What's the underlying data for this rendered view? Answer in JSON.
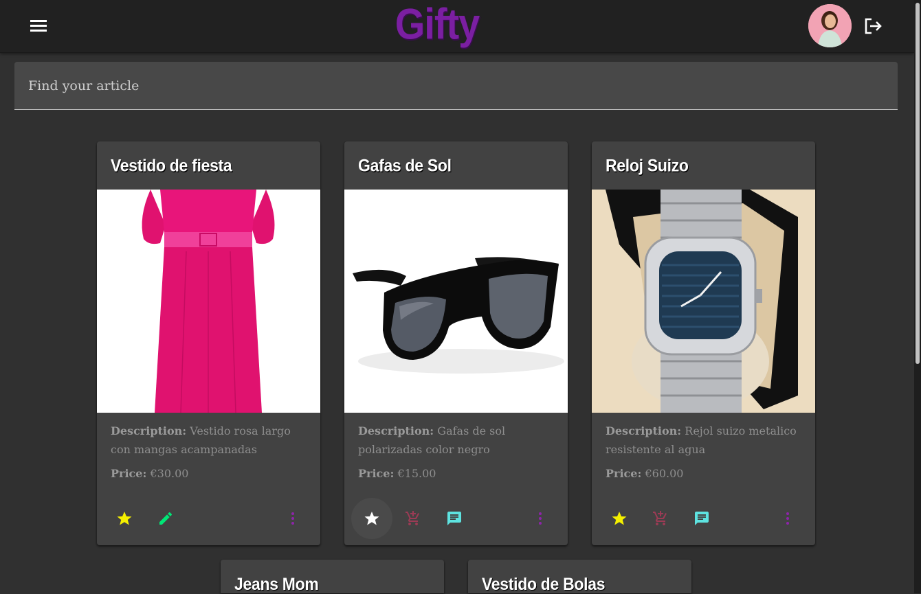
{
  "app": {
    "title": "Gifty"
  },
  "search": {
    "placeholder": "Find your article"
  },
  "labels": {
    "description": "Description:",
    "price": "Price:"
  },
  "colors": {
    "brand": "#7b1fa2",
    "star": "#f5f000",
    "edit": "#00e676",
    "cart": "#9c3b55",
    "comment": "#5ee3e0",
    "more": "#8e24aa"
  },
  "products": [
    {
      "title": "Vestido de fiesta",
      "description": "Vestido rosa largo con mangas acampanadas",
      "price": "€30.00",
      "actions": [
        "star-icon",
        "edit-icon",
        "more-vert-icon"
      ]
    },
    {
      "title": "Gafas de Sol",
      "description": "Gafas de sol polarizadas color negro",
      "price": "€15.00",
      "actions": [
        "star-icon",
        "add-cart-icon",
        "comment-icon",
        "more-vert-icon"
      ]
    },
    {
      "title": "Reloj Suizo",
      "description": "Rejol suizo metalico resistente al agua",
      "price": "€60.00",
      "actions": [
        "star-icon",
        "add-cart-icon",
        "comment-icon",
        "more-vert-icon"
      ]
    },
    {
      "title": "Jeans Mom"
    },
    {
      "title": "Vestido de Bolas"
    }
  ]
}
